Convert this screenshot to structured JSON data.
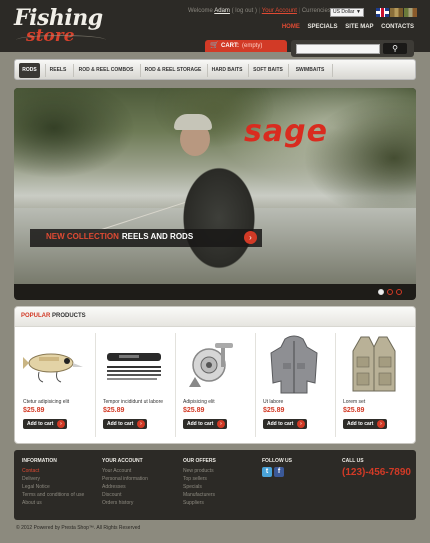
{
  "logo": {
    "line1": "Fishing",
    "line2": "store"
  },
  "topbar": {
    "welcome": "Welcome",
    "user": "Adam",
    "logout": "( log out )",
    "account": "Your Account",
    "currencies": "Currencies:",
    "currency_value": "US Dollar",
    "flags": [
      "english-flag-icon",
      "french-flag-icon",
      "italian-flag-icon"
    ]
  },
  "mainnav": [
    "HOME",
    "SPECIALS",
    "SITE MAP",
    "CONTACTS"
  ],
  "cart": {
    "label": "CART:",
    "status": "(empty)"
  },
  "search": {
    "placeholder": "",
    "button_icon": "search-icon"
  },
  "categories": [
    "RODS",
    "REELS",
    "ROD & REEL COMBOS",
    "ROD & REEL STORAGE",
    "HARD BAITS",
    "SOFT BAITS",
    "SWIMBAITS"
  ],
  "slider": {
    "brand": "sage",
    "caption_highlight": "NEW COLLECTION",
    "caption_rest": "REELS AND RODS",
    "next_icon": "chevron-right-icon",
    "slide_count": 3,
    "active_slide": 1
  },
  "products": {
    "title_highlight": "POPULAR",
    "title_rest": "PRODUCTS",
    "add_label": "Add to cart",
    "items": [
      {
        "name": "Ctetur adipisicing elit",
        "price": "$25.89"
      },
      {
        "name": "Tempor incididunt ut labore",
        "price": "$25.89"
      },
      {
        "name": "Adipisicing elit",
        "price": "$25.89"
      },
      {
        "name": "Ut labore",
        "price": "$25.89"
      },
      {
        "name": "Lorem set",
        "price": "$25.89"
      }
    ]
  },
  "footer": {
    "columns": [
      {
        "heading": "INFORMATION",
        "links": [
          "Contact",
          "Delivery",
          "Legal Notice",
          "Terms and conditions of use",
          "About us"
        ]
      },
      {
        "heading": "YOUR ACCOUNT",
        "links": [
          "Your Account",
          "Personal information",
          "Addresses",
          "Discount",
          "Orders history"
        ]
      },
      {
        "heading": "OUR OFFERS",
        "links": [
          "New products",
          "Top sellers",
          "Specials",
          "Manufacturers",
          "Suppliers"
        ]
      },
      {
        "heading": "FOLLOW US",
        "links": []
      },
      {
        "heading": "CALL US",
        "links": []
      }
    ],
    "phone": "(123)-456-7890",
    "social": {
      "twitter": "t",
      "facebook": "f"
    }
  },
  "copyright": "© 2012 Powered by Presta Shop™. All Rights Reserved",
  "colors": {
    "accent": "#d23a26",
    "dark": "#2c2a26",
    "page_bg": "#8c8a7e"
  }
}
